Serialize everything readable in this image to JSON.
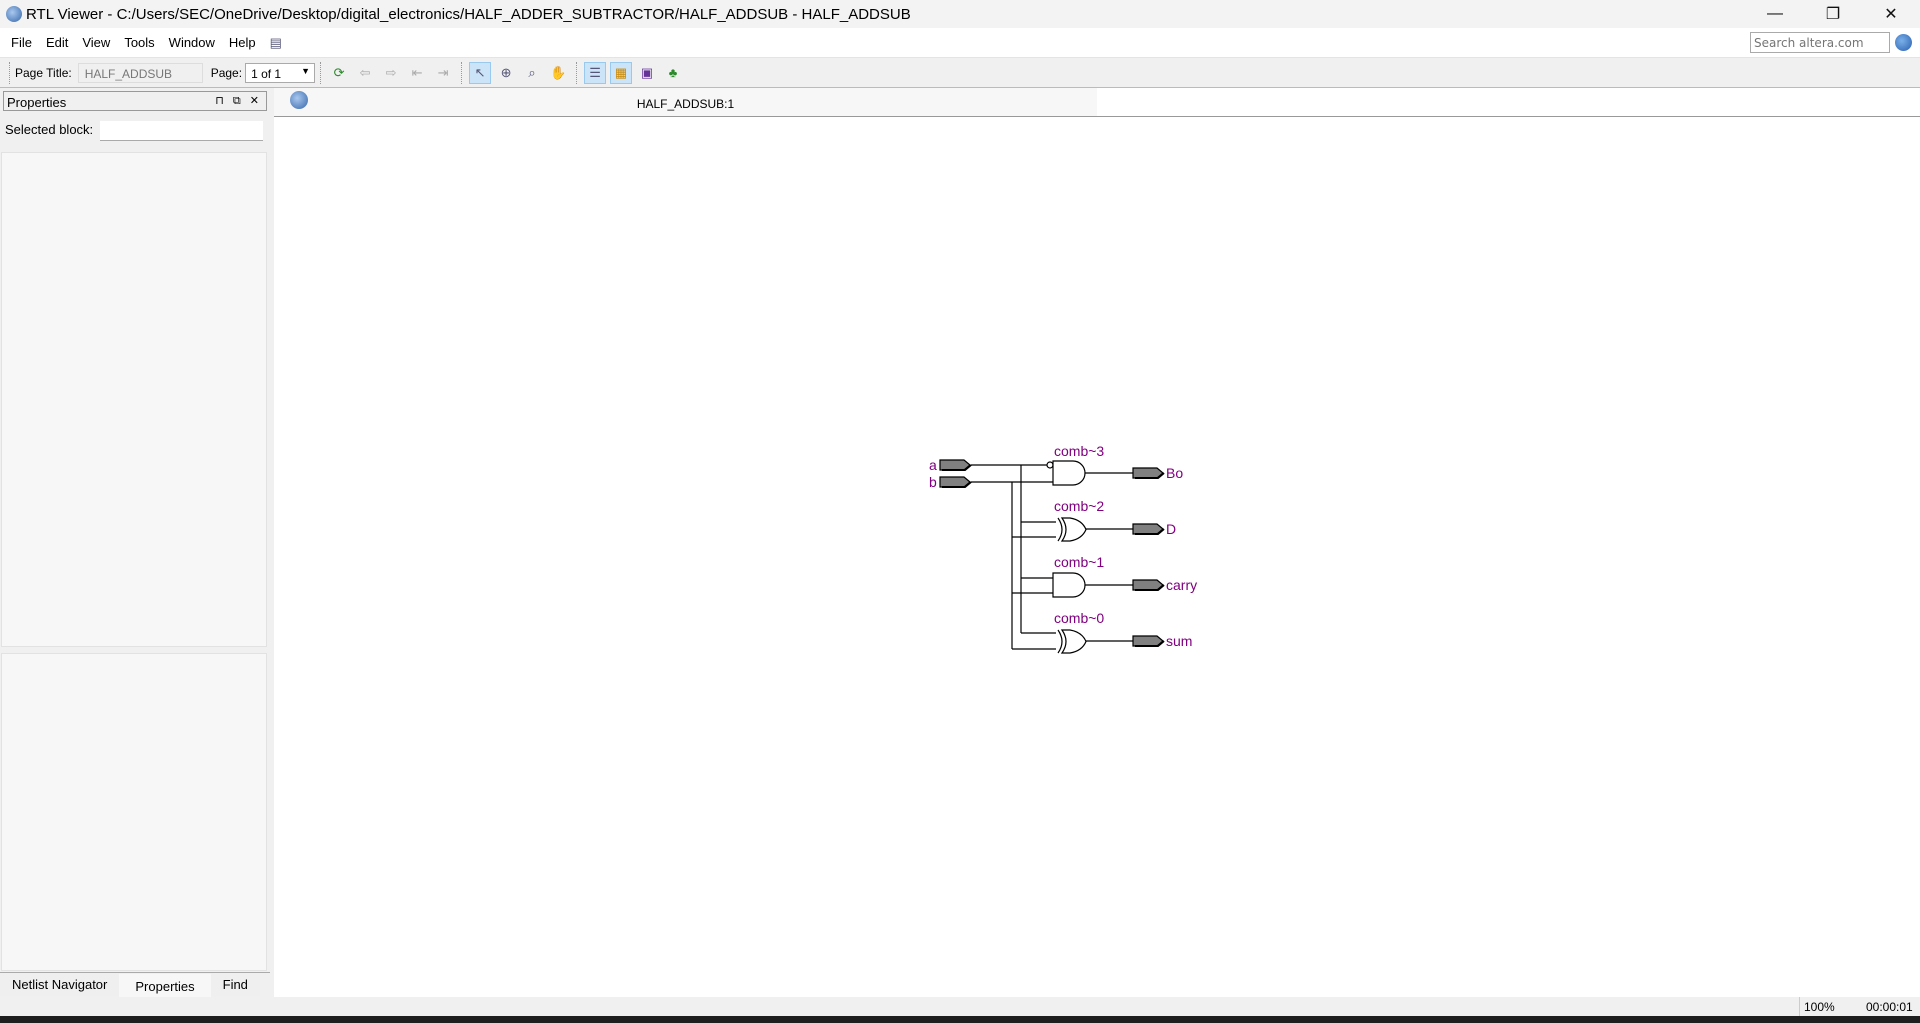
{
  "window": {
    "title": "RTL Viewer - C:/Users/SEC/OneDrive/Desktop/digital_electronics/HALF_ADDER_SUBTRACTOR/HALF_ADDSUB - HALF_ADDSUB",
    "minimize": "—",
    "restore": "❐",
    "close": "✕"
  },
  "menu": [
    "File",
    "Edit",
    "View",
    "Tools",
    "Window",
    "Help"
  ],
  "search": {
    "placeholder": "Search altera.com"
  },
  "toolbar": {
    "page_title_label": "Page Title:",
    "page_title_value": "HALF_ADDSUB",
    "page_label": "Page:",
    "page_value": "1 of 1"
  },
  "properties": {
    "title": "Properties",
    "controls": "⊓ ⧉ ✕",
    "selected_block_label": "Selected block:",
    "selected_block_value": ""
  },
  "bottom_tabs": [
    "Netlist Navigator",
    "Properties",
    "Find"
  ],
  "canvas_tab": "HALF_ADDSUB:1",
  "schematic": {
    "inputs": [
      "a",
      "b"
    ],
    "gates": [
      {
        "name": "comb~3",
        "type": "AND",
        "inverted_input": "a",
        "output": "Bo"
      },
      {
        "name": "comb~2",
        "type": "XOR",
        "output": "D"
      },
      {
        "name": "comb~1",
        "type": "AND",
        "output": "carry"
      },
      {
        "name": "comb~0",
        "type": "XOR",
        "output": "sum"
      }
    ]
  },
  "status": {
    "zoom": "100%",
    "time": "00:00:01"
  }
}
